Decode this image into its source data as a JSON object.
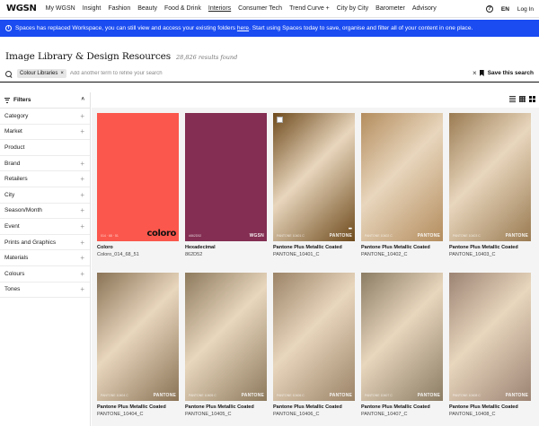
{
  "nav": {
    "logo": "WGSN",
    "links": [
      "My WGSN",
      "Insight",
      "Fashion",
      "Beauty",
      "Food & Drink",
      "Interiors",
      "Consumer Tech",
      "Trend Curve +",
      "City by City",
      "Barometer",
      "Advisory"
    ],
    "help": "?",
    "lang": "EN",
    "login": "Log In"
  },
  "banner": {
    "icon": "i",
    "text_before": "Spaces has replaced Workspace, you can still view and access your existing folders ",
    "link": "here",
    "text_after": ". Start using Spaces today to save, organise and filter all of your content in one place."
  },
  "heading": {
    "title": "Image Library & Design Resources",
    "count": "28,826 results found"
  },
  "search": {
    "chip": "Colour Libraries",
    "chip_remove": "×",
    "placeholder": "Add another term to refine your search",
    "clear": "×",
    "save": "Save this search"
  },
  "filters": {
    "header": "Filters",
    "collapse": "˄",
    "items": [
      {
        "label": "Category",
        "expand": "+"
      },
      {
        "label": "Market",
        "expand": "+"
      },
      {
        "label": "Product",
        "expand": ""
      },
      {
        "label": "Brand",
        "expand": "+"
      },
      {
        "label": "Retailers",
        "expand": "+"
      },
      {
        "label": "City",
        "expand": "+"
      },
      {
        "label": "Season/Month",
        "expand": "+"
      },
      {
        "label": "Event",
        "expand": "+"
      },
      {
        "label": "Prints and Graphics",
        "expand": "+"
      },
      {
        "label": "Materials",
        "expand": "+"
      },
      {
        "label": "Colours",
        "expand": "+"
      },
      {
        "label": "Tones",
        "expand": "+"
      }
    ]
  },
  "cards": [
    {
      "title": "Coloro",
      "sub": "Coloro_014_68_51",
      "color": "#fb574c",
      "code": "014 · 68 · 51",
      "brand": "coloro"
    },
    {
      "title": "Hexadecimal",
      "sub": "862D52",
      "color": "#832e52",
      "code": "#862D52",
      "brand": "WGSN"
    },
    {
      "title": "Pantone Plus Metallic Coated",
      "sub": "PANTONE_10401_C",
      "color": "#6e4a1c",
      "code": "PANTONE 10401 C",
      "brand": "PANTONE"
    },
    {
      "title": "Pantone Plus Metallic Coated",
      "sub": "PANTONE_10402_C",
      "color": "#b48d5e",
      "code": "PANTONE 10402 C",
      "brand": "PANTONE"
    },
    {
      "title": "Pantone Plus Metallic Coated",
      "sub": "PANTONE_10403_C",
      "color": "#9a7b52",
      "code": "PANTONE 10403 C",
      "brand": "PANTONE"
    },
    {
      "title": "Pantone Plus Metallic Coated",
      "sub": "PANTONE_10404_C",
      "color": "#8a7356",
      "code": "PANTONE 10404 C",
      "brand": "PANTONE"
    },
    {
      "title": "Pantone Plus Metallic Coated",
      "sub": "PANTONE_10405_C",
      "color": "#8d7a5d",
      "code": "PANTONE 10405 C",
      "brand": "PANTONE"
    },
    {
      "title": "Pantone Plus Metallic Coated",
      "sub": "PANTONE_10406_C",
      "color": "#9b8367",
      "code": "PANTONE 10406 C",
      "brand": "PANTONE"
    },
    {
      "title": "Pantone Plus Metallic Coated",
      "sub": "PANTONE_10407_C",
      "color": "#8b7c64",
      "code": "PANTONE 10407 C",
      "brand": "PANTONE"
    },
    {
      "title": "Pantone Plus Metallic Coated",
      "sub": "PANTONE_10408_C",
      "color": "#9c8373",
      "code": "PANTONE 10408 C",
      "brand": "PANTONE"
    }
  ]
}
